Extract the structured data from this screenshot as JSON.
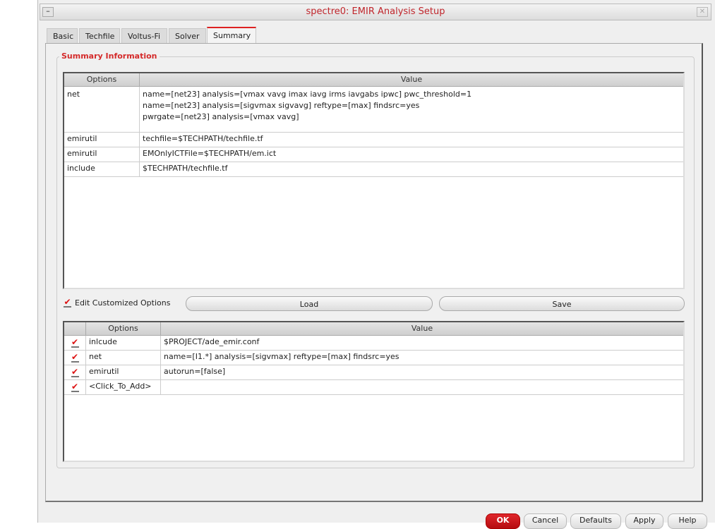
{
  "window": {
    "title": "spectre0: EMIR Analysis Setup",
    "menu_icon": "minus-icon",
    "close_icon": "close-icon"
  },
  "tabs": [
    {
      "label": "Basic"
    },
    {
      "label": "Techfile"
    },
    {
      "label": "Voltus-Fi"
    },
    {
      "label": "Solver"
    },
    {
      "label": "Summary",
      "active": true
    }
  ],
  "summary": {
    "group_title": "Summary Information",
    "columns": [
      "Options",
      "Value"
    ],
    "rows": [
      {
        "option": "net",
        "values": [
          "name=[net23] analysis=[vmax vavg imax iavg irms iavgabs ipwc] pwc_threshold=1",
          "name=[net23] analysis=[sigvmax sigvavg] reftype=[max] findsrc=yes",
          "pwrgate=[net23] analysis=[vmax vavg]"
        ]
      },
      {
        "option": "emirutil",
        "values": [
          "techfile=$TECHPATH/techfile.tf"
        ]
      },
      {
        "option": "emirutil",
        "values": [
          "EMOnlyICTFile=$TECHPATH/em.ict"
        ]
      },
      {
        "option": "include",
        "values": [
          "$TECHPATH/techfile.tf"
        ]
      }
    ]
  },
  "custom": {
    "checkbox_label": "Edit Customized Options",
    "checked": true,
    "load_label": "Load",
    "save_label": "Save",
    "columns": [
      "Options",
      "Value"
    ],
    "rows": [
      {
        "checked": true,
        "option": "inlcude",
        "value": "$PROJECT/ade_emir.conf"
      },
      {
        "checked": true,
        "option": "net",
        "value": "name=[I1.*] analysis=[sigvmax] reftype=[max] findsrc=yes"
      },
      {
        "checked": true,
        "option": "emirutil",
        "value": "autorun=[false]"
      },
      {
        "checked": true,
        "option": "<Click_To_Add>",
        "value": ""
      }
    ]
  },
  "buttons": {
    "ok": "OK",
    "cancel": "Cancel",
    "defaults": "Defaults",
    "apply": "Apply",
    "help": "Help"
  },
  "colors": {
    "accent": "#d42a2a",
    "ok_button": "#c80f14"
  }
}
